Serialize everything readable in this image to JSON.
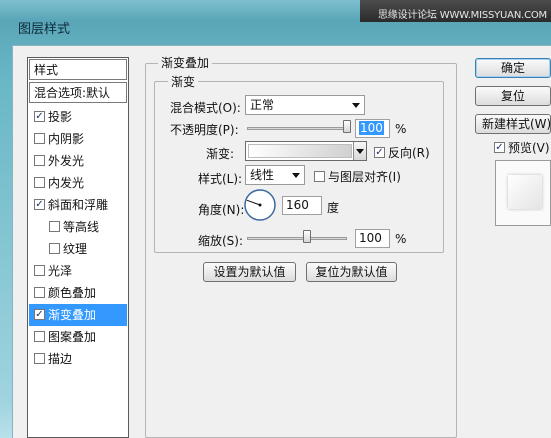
{
  "window": {
    "title": "图层样式",
    "watermark": "思缘设计论坛 WWW.MISSYUAN.COM"
  },
  "style_list": {
    "header": "样式",
    "blend_header": "混合选项:默认",
    "items": [
      {
        "label": "投影",
        "checked": true
      },
      {
        "label": "内阴影",
        "checked": false
      },
      {
        "label": "外发光",
        "checked": false
      },
      {
        "label": "内发光",
        "checked": false
      },
      {
        "label": "斜面和浮雕",
        "checked": true
      },
      {
        "label": "等高线",
        "checked": false
      },
      {
        "label": "纹理",
        "checked": false
      },
      {
        "label": "光泽",
        "checked": false
      },
      {
        "label": "颜色叠加",
        "checked": false
      },
      {
        "label": "渐变叠加",
        "checked": true,
        "selected": true
      },
      {
        "label": "图案叠加",
        "checked": false
      },
      {
        "label": "描边",
        "checked": false
      }
    ]
  },
  "gradient_overlay": {
    "section_title": "渐变叠加",
    "group_title": "渐变",
    "blend_mode_label": "混合模式(O):",
    "blend_mode_value": "正常",
    "opacity_label": "不透明度(P):",
    "opacity_value": "100",
    "opacity_percent": 100,
    "opacity_unit": "%",
    "gradient_label": "渐变:",
    "reverse_label": "反向(R)",
    "reverse_checked": true,
    "style_label": "样式(L):",
    "style_value": "线性",
    "align_label": "与图层对齐(I)",
    "align_checked": false,
    "angle_label": "角度(N):",
    "angle_value": "160",
    "angle_degrees": 160,
    "angle_unit": "度",
    "scale_label": "缩放(S):",
    "scale_value": "100",
    "scale_percent": 100,
    "scale_unit": "%",
    "make_default_label": "设置为默认值",
    "reset_default_label": "复位为默认值"
  },
  "right_panel": {
    "ok_label": "确定",
    "reset_label": "复位",
    "new_style_label": "新建样式(W)...",
    "preview_label": "预览(V)",
    "preview_checked": true
  },
  "colors": {
    "selection": "#3399ff",
    "window_teal": "#5aa6b8",
    "dialog_bg": "#f0f0f0"
  }
}
